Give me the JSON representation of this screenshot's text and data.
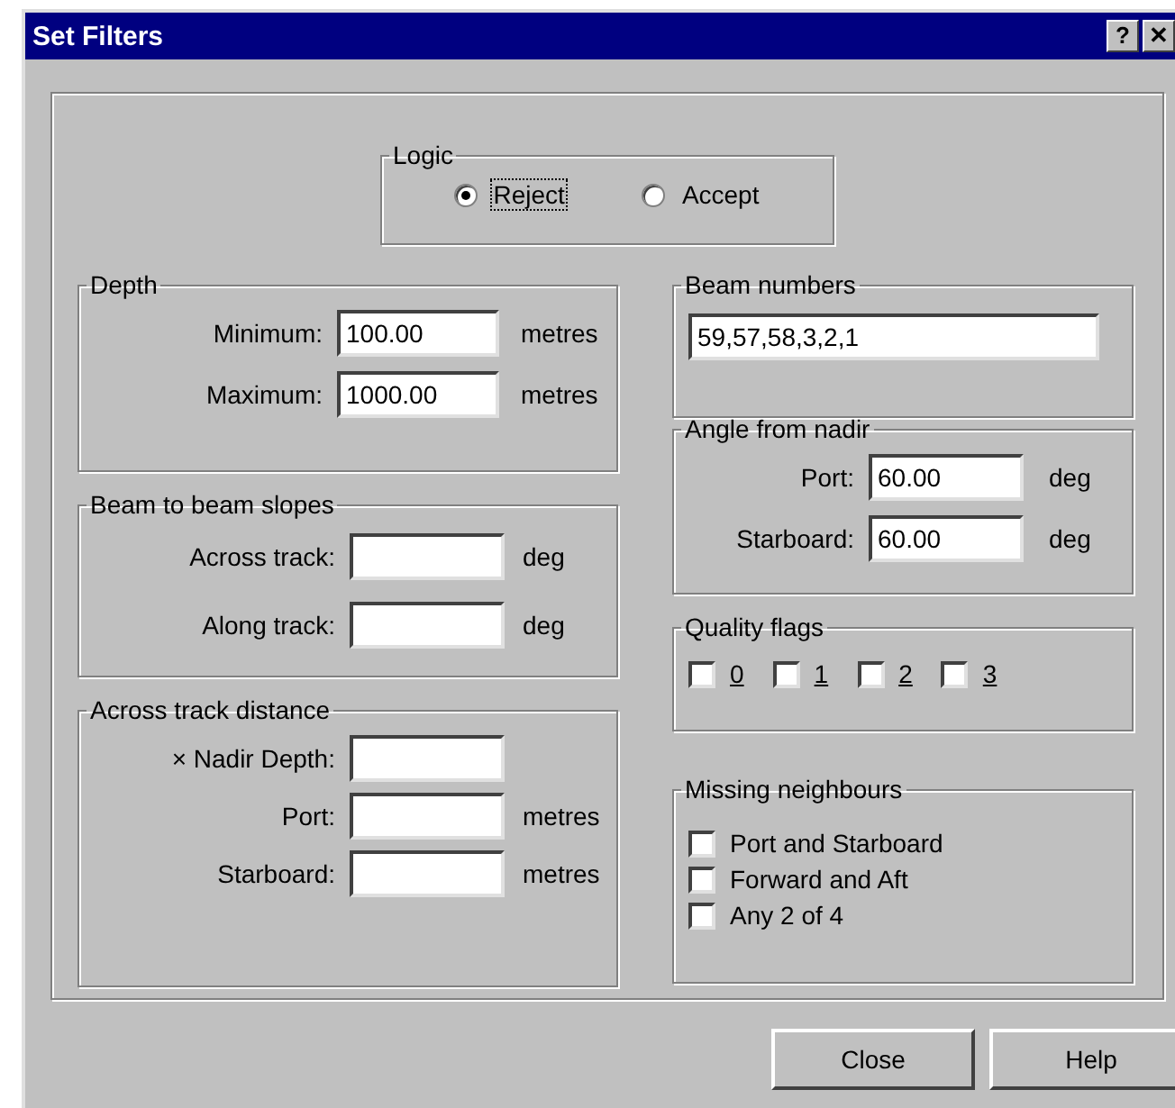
{
  "window": {
    "title": "Set Filters",
    "title_buttons": [
      "?",
      "✕"
    ]
  },
  "logic": {
    "title": "Logic",
    "options": [
      {
        "label": "Reject",
        "selected": true,
        "focused": true
      },
      {
        "label": "Accept",
        "selected": false,
        "focused": false
      }
    ]
  },
  "depth": {
    "title": "Depth",
    "rows": [
      {
        "label": "Minimum:",
        "value": "100.00",
        "unit": "metres"
      },
      {
        "label": "Maximum:",
        "value": "1000.00",
        "unit": "metres"
      }
    ]
  },
  "beam_slopes": {
    "title": "Beam to beam slopes",
    "rows": [
      {
        "label": "Across track:",
        "unit": "deg"
      },
      {
        "label": "Along track:",
        "unit": "deg"
      }
    ]
  },
  "across_track_distance": {
    "title": "Across track distance",
    "rows": [
      {
        "label": "× Nadir Depth:"
      },
      {
        "label": "Port:",
        "unit": "metres"
      },
      {
        "label": "Starboard:",
        "unit": "metres"
      }
    ]
  },
  "beam_numbers": {
    "title": "Beam numbers",
    "value": "59,57,58,3,2,1"
  },
  "angle_from_nadir": {
    "title": "Angle from nadir",
    "rows": [
      {
        "label": "Port:",
        "value": "60.00",
        "unit": "deg"
      },
      {
        "label": "Starboard:",
        "value": "60.00",
        "unit": "deg"
      }
    ]
  },
  "quality_flags": {
    "title": "Quality flags",
    "items": [
      {
        "label": "0",
        "checked": false
      },
      {
        "label": "1",
        "checked": false
      },
      {
        "label": "2",
        "checked": false
      },
      {
        "label": "3",
        "checked": false
      }
    ]
  },
  "missing_neighbours": {
    "title": "Missing neighbours",
    "items": [
      {
        "label": "Port and Starboard",
        "checked": false
      },
      {
        "label": "Forward and Aft",
        "checked": false
      },
      {
        "label": "Any 2 of 4",
        "checked": false
      }
    ]
  },
  "buttons": [
    "Close",
    "Help"
  ]
}
